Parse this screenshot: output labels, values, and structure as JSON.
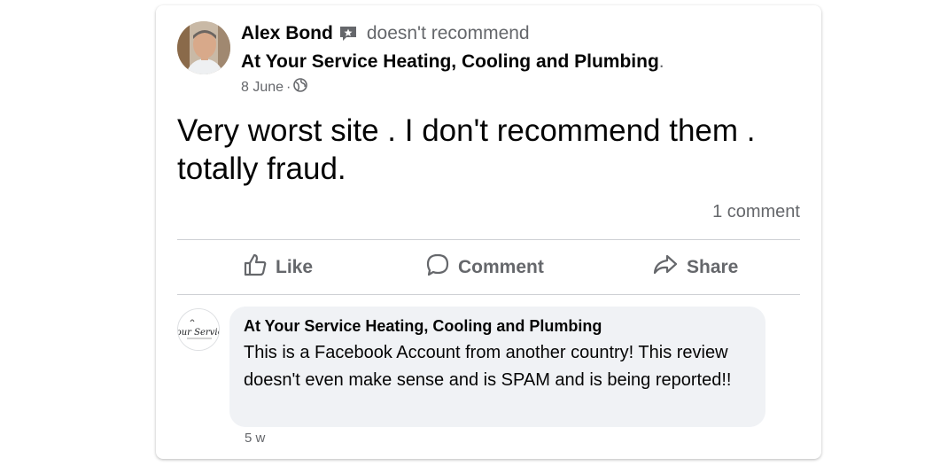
{
  "post": {
    "author": "Alex Bond",
    "recommend_status": "doesn't recommend",
    "page_name": "At Your Service Heating, Cooling and Plumbing",
    "page_name_suffix": ".",
    "date": "8 June",
    "date_separator": "·",
    "privacy_icon": "globe-icon",
    "text": "Very worst site . I don't recommend them . totally fraud.",
    "comment_count": "1 comment"
  },
  "actions": {
    "like_label": "Like",
    "like_icon": "thumbs-up-icon",
    "comment_label": "Comment",
    "comment_icon": "speech-bubble-icon",
    "share_label": "Share",
    "share_icon": "share-arrow-icon"
  },
  "comment": {
    "author": "At Your Service Heating, Cooling and Plumbing",
    "text": "This is a Facebook Account from another country! This review doesn't even make sense and is SPAM and is being reported!!",
    "time": "5 w",
    "avatar_logo_text": "Your Service"
  },
  "colors": {
    "text_primary": "#050505",
    "text_secondary": "#65676b",
    "divider": "#ced0d4",
    "bubble_bg": "#f0f2f5"
  }
}
